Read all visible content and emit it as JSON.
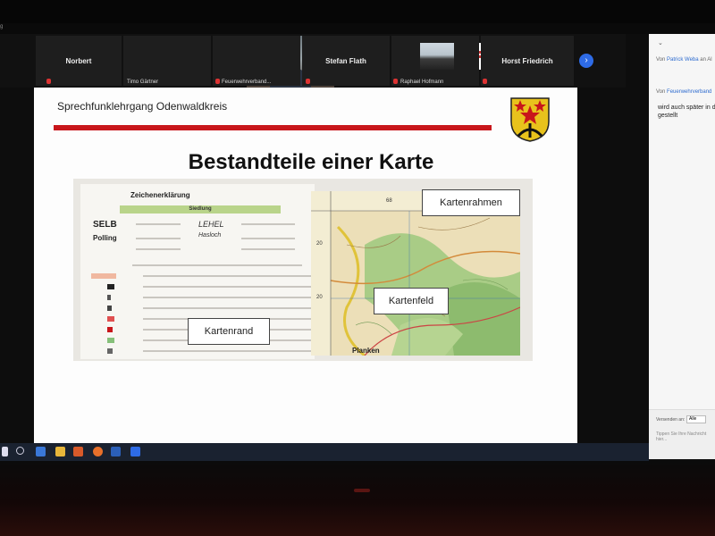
{
  "window": {
    "corner_label": "g"
  },
  "participants": [
    {
      "name": "Norbert",
      "sub": ""
    },
    {
      "name": "",
      "sub": "Timo Gärtner"
    },
    {
      "name": "",
      "sub": "Feuerwehrverband..."
    },
    {
      "name": "Stefan Flath",
      "sub": ""
    },
    {
      "name": "",
      "sub": "Raphael Hofmann"
    },
    {
      "name": "Horst Friedrich",
      "sub": ""
    }
  ],
  "next_button": "›",
  "chat": {
    "line1_prefix": "Von",
    "line1_name": "Patrick Weba",
    "line1_suffix": "an Al",
    "line2_prefix": "Von",
    "line2_name": "Feuerwehrverband",
    "message": "wird auch später in d gestellt",
    "send_to_label": "Versenden an:",
    "send_to_value": "Alle",
    "input_placeholder": "Tippen Sie Ihre Nachricht hier..."
  },
  "slide": {
    "header": "Sprechfunklehrgang Odenwaldkreis",
    "title": "Bestandteile einer Karte",
    "legend": {
      "title": "Zeichenerklärung",
      "band": "Siedlung",
      "big1": "SELB",
      "big2": "Polling",
      "ital1": "LEHEL",
      "ital2": "Hasloch"
    },
    "map_labels": {
      "top": "68",
      "left_a": "20",
      "left_b": "20",
      "bottom": "Planken"
    },
    "callouts": {
      "frame": "Kartenrahmen",
      "field": "Kartenfeld",
      "edge": "Kartenrand"
    }
  },
  "colors": {
    "accent_red": "#c8161b",
    "zoom_blue": "#2e6be6",
    "map_green": "#9fc47b"
  }
}
